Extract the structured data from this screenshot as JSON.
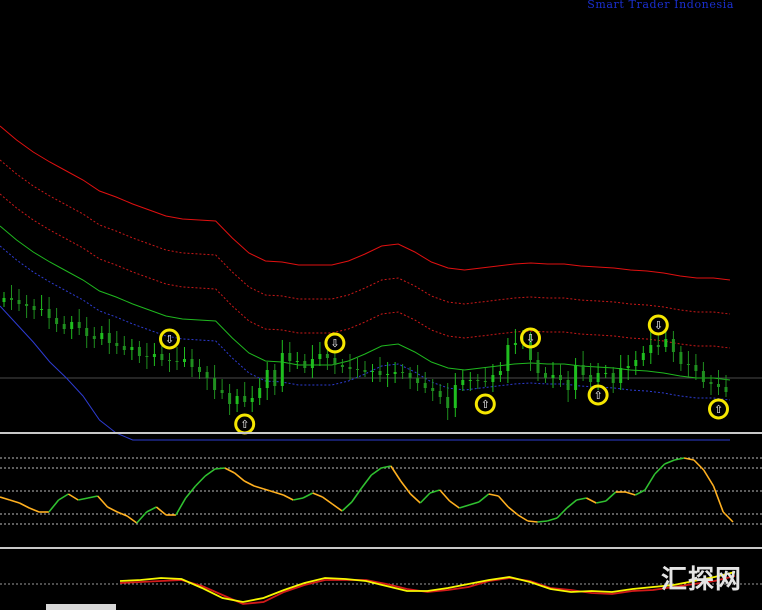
{
  "header": {
    "watermark": "Smart Trader Indonesia"
  },
  "footer": {
    "logo_text": "汇探网"
  },
  "colors": {
    "background": "#000000",
    "candle_up": "#1fbe1f",
    "candle_down": "#1f8f1f",
    "band_outer_red": "#e01010",
    "band_red": "#c81818",
    "band_blue": "#2d3bd0",
    "ma_green": "#1fb81f",
    "signal_ring": "#f5e600",
    "oscillator_down": "#ffb020",
    "oscillator_up": "#30c030",
    "macd_main": "#d21a1a",
    "macd_signal": "#f7f700",
    "panel_divider": "#c8c8c8"
  },
  "chart_data": [
    {
      "type": "line",
      "panel": "price",
      "series": [
        {
          "kind": "candles",
          "color": "#1fbe1f",
          "values": [
            298,
            300,
            304,
            306,
            310,
            309,
            318,
            324,
            329,
            322,
            328,
            336,
            339,
            333,
            343,
            346,
            350,
            347,
            356,
            357,
            354,
            360,
            361,
            362,
            359,
            367,
            372,
            378,
            390,
            393,
            404,
            396,
            402,
            398,
            388,
            370,
            386,
            353,
            361,
            361,
            368,
            359,
            354,
            358,
            365,
            367,
            369,
            370,
            372,
            371,
            375,
            374,
            372,
            373,
            378,
            383,
            388,
            391,
            397,
            408,
            385,
            380,
            380,
            381,
            382,
            375,
            371,
            345,
            343,
            342,
            360,
            373,
            378,
            375,
            380,
            390,
            365,
            375,
            382,
            373,
            373,
            383,
            368,
            366,
            360,
            353,
            345,
            347,
            339,
            352,
            364,
            365,
            371,
            382,
            384,
            387,
            392
          ]
        },
        {
          "kind": "band",
          "color": "#e01010",
          "values": [
            126,
            140,
            152,
            162,
            171,
            180,
            191,
            197,
            204,
            210,
            216,
            219,
            220,
            221,
            238,
            253,
            261,
            262,
            265,
            265,
            265,
            261,
            254,
            246,
            244,
            252,
            262,
            268,
            270,
            268,
            266,
            264,
            263,
            264,
            264,
            266,
            267,
            268,
            270,
            271,
            273,
            276,
            278,
            278,
            280
          ]
        },
        {
          "kind": "band",
          "color": "#c81818",
          "dotted": true,
          "values": [
            160,
            174,
            186,
            196,
            205,
            214,
            225,
            231,
            238,
            244,
            250,
            253,
            254,
            255,
            272,
            287,
            295,
            296,
            299,
            299,
            299,
            295,
            288,
            280,
            278,
            286,
            296,
            302,
            304,
            302,
            300,
            298,
            297,
            298,
            298,
            300,
            301,
            302,
            304,
            305,
            307,
            310,
            312,
            312,
            314
          ]
        },
        {
          "kind": "band",
          "color": "#c81818",
          "dotted": true,
          "values": [
            194,
            208,
            220,
            230,
            239,
            248,
            259,
            265,
            272,
            278,
            284,
            287,
            288,
            289,
            306,
            321,
            329,
            330,
            333,
            333,
            333,
            329,
            322,
            314,
            312,
            320,
            330,
            336,
            338,
            336,
            334,
            332,
            331,
            332,
            332,
            334,
            335,
            336,
            338,
            339,
            341,
            344,
            346,
            346,
            348
          ]
        },
        {
          "kind": "band",
          "color": "#2d3bd0",
          "dotted": true,
          "values": [
            246,
            260,
            272,
            282,
            291,
            300,
            311,
            317,
            324,
            330,
            336,
            339,
            340,
            341,
            358,
            373,
            381,
            382,
            385,
            385,
            385,
            381,
            374,
            366,
            364,
            372,
            382,
            388,
            390,
            388,
            386,
            384,
            383,
            384,
            384,
            386,
            387,
            388,
            390,
            391,
            393,
            396,
            398,
            398,
            400
          ]
        },
        {
          "kind": "band",
          "color": "#2d3bd0",
          "values": [
            306,
            324,
            342,
            362,
            378,
            396,
            420,
            433,
            440,
            440,
            440,
            440,
            440,
            440,
            440,
            440,
            440,
            440,
            440,
            440,
            440,
            440,
            440,
            440,
            440,
            440,
            440,
            440,
            440,
            440,
            440,
            440,
            440,
            440,
            440,
            440,
            440,
            440,
            440,
            440,
            440,
            440,
            440,
            440,
            440
          ]
        },
        {
          "kind": "band",
          "color": "#1fb81f",
          "values": [
            226,
            240,
            252,
            262,
            271,
            280,
            291,
            297,
            304,
            310,
            316,
            319,
            320,
            321,
            338,
            353,
            361,
            362,
            365,
            365,
            365,
            361,
            354,
            346,
            344,
            352,
            362,
            368,
            370,
            368,
            366,
            364,
            363,
            364,
            364,
            366,
            367,
            368,
            370,
            371,
            373,
            376,
            378,
            378,
            380
          ]
        }
      ],
      "signals": [
        {
          "symbol": "⇩",
          "candle": 22
        },
        {
          "symbol": "⇧",
          "candle": 32
        },
        {
          "symbol": "⇩",
          "candle": 44
        },
        {
          "symbol": "⇧",
          "candle": 64
        },
        {
          "symbol": "⇩",
          "candle": 70
        },
        {
          "symbol": "⇧",
          "candle": 79
        },
        {
          "symbol": "⇩",
          "candle": 87
        },
        {
          "symbol": "⇧",
          "candle": 95
        }
      ]
    },
    {
      "type": "line",
      "panel": "oscillator",
      "levels": [
        458,
        468,
        491,
        514,
        524
      ],
      "series": [
        {
          "values": [
            497,
            500,
            503,
            508,
            512,
            512,
            500,
            494,
            500,
            498,
            496,
            507,
            512,
            516,
            523,
            512,
            507,
            515,
            515,
            498,
            486,
            476,
            469,
            468,
            473,
            481,
            486,
            489,
            492,
            495,
            500,
            498,
            493,
            497,
            504,
            511,
            502,
            488,
            475,
            468,
            466,
            481,
            494,
            503,
            493,
            490,
            501,
            508,
            505,
            502,
            494,
            496,
            507,
            515,
            521,
            522,
            521,
            518,
            508,
            500,
            498,
            503,
            501,
            492,
            492,
            495,
            490,
            474,
            464,
            460,
            458,
            460,
            470,
            486,
            512,
            522
          ]
        }
      ]
    },
    {
      "type": "line",
      "panel": "macd",
      "levels": [
        584
      ],
      "series": [
        {
          "color": "#d21a1a",
          "values": [
            583,
            582,
            581,
            580,
            586,
            595,
            604,
            602,
            592,
            585,
            580,
            580,
            580,
            584,
            589,
            592,
            590,
            587,
            581,
            578,
            581,
            588,
            590,
            593,
            594,
            591,
            590,
            587,
            584,
            581,
            576
          ]
        },
        {
          "color": "#f7f700",
          "values": [
            581,
            580,
            578,
            579,
            588,
            598,
            602,
            598,
            590,
            583,
            578,
            579,
            581,
            586,
            591,
            591,
            588,
            584,
            580,
            577,
            582,
            589,
            592,
            591,
            592,
            589,
            587,
            585,
            581,
            577,
            572
          ]
        }
      ]
    }
  ]
}
